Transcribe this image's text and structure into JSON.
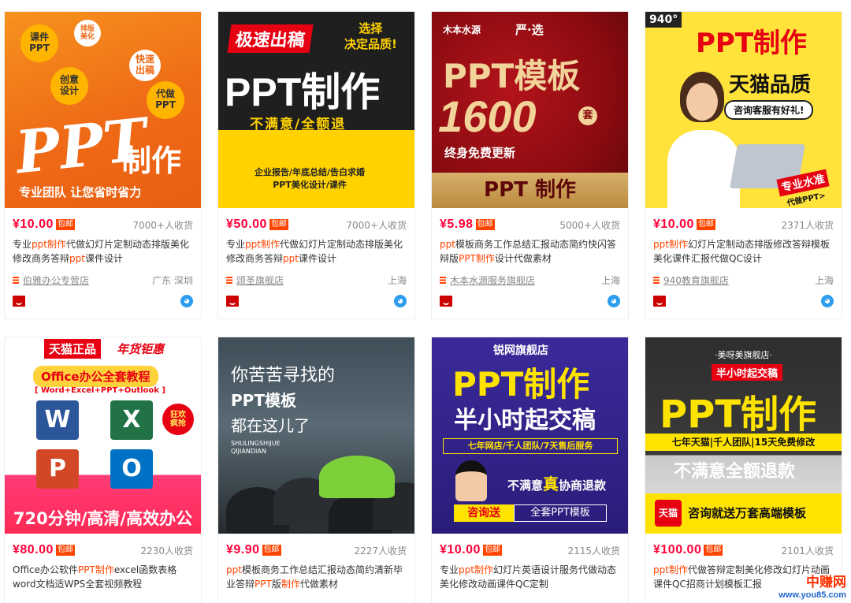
{
  "products": [
    {
      "price": "¥10.00",
      "baoyou": "包邮",
      "sales": "7000+人收货",
      "title_segments": [
        [
          "专业",
          false
        ],
        [
          "ppt制作",
          true
        ],
        [
          "代做幻灯片定制动态排版美化修改商务答辩",
          false
        ],
        [
          "ppt",
          true
        ],
        [
          "课件设计",
          false
        ]
      ],
      "shop": "伯雅办公专营店",
      "location": "广东 深圳",
      "image": {
        "bubbles": [
          "课件\nPPT",
          "排版\n美化",
          "快速\n出稿",
          "创意\n设计",
          "代做\nPPT"
        ],
        "big": "PPT",
        "big2": "制作",
        "sub": "专业团队 让您省时省力"
      }
    },
    {
      "price": "¥50.00",
      "baoyou": "包邮",
      "sales": "7000+人收货",
      "title_segments": [
        [
          "专业",
          false
        ],
        [
          "ppt制作",
          true
        ],
        [
          "代做幻灯片定制动态排版美化修改商务答辩",
          false
        ],
        [
          "ppt",
          true
        ],
        [
          "课件设计",
          false
        ]
      ],
      "shop": "颂圣旗舰店",
      "location": "上海",
      "image": {
        "tag": "极速出稿",
        "side": "选择\n决定品质!",
        "big": "PPT制作",
        "sub": "不满意/全额退",
        "foot": "企业报告/年底总结/告白求婚\nPPT美化设计/课件"
      }
    },
    {
      "price": "¥5.98",
      "baoyou": "包邮",
      "sales": "5000+人收货",
      "title_segments": [
        [
          "ppt",
          true
        ],
        [
          "模板商务工作总结汇报动态简约快闪答辩版",
          false
        ],
        [
          "PPT制作",
          true
        ],
        [
          "设计代做素材",
          false
        ]
      ],
      "shop": "木本水源服务旗舰店",
      "location": "上海",
      "image": {
        "brand": "木本水源",
        "brand2": "严·选",
        "big": "PPT模板",
        "num": "1600",
        "unit": "套",
        "sub": "终身免费更新",
        "foot": "PPT 制作"
      }
    },
    {
      "price": "¥10.00",
      "baoyou": "包邮",
      "sales": "2371人收货",
      "title_segments": [
        [
          "ppt制作",
          true
        ],
        [
          "幻灯片定制动态排版修改答辩模板美化课件汇报代做QC设计",
          false
        ]
      ],
      "shop": "940教育旗舰店",
      "location": "上海",
      "image": {
        "corner": "940°",
        "big": "PPT制作",
        "sub": "天猫品质",
        "note": "咨询客服有好礼!",
        "tag": "专业水准",
        "tag2": "代做PPT>"
      }
    },
    {
      "price": "¥80.00",
      "baoyou": "包邮",
      "sales": "2230人收货",
      "title_segments": [
        [
          "Office办公软件",
          false
        ],
        [
          "PPT制作",
          true
        ],
        [
          "excel函数表格word文档适WPS全套视频教程",
          false
        ]
      ],
      "shop": "",
      "location": "",
      "image": {
        "top": "天猫正品",
        "top2": "年货钜惠",
        "title": "Office办公全套教程",
        "sub": "[ Word+Excel+PPT+Outlook ]",
        "badge": "狂欢\n疯抢",
        "foot": "720分钟/高清/高效办公"
      }
    },
    {
      "price": "¥9.90",
      "baoyou": "包邮",
      "sales": "2227人收货",
      "title_segments": [
        [
          "ppt",
          true
        ],
        [
          "模板商务工作总结汇报动态简约清新毕业答辩",
          false
        ],
        [
          "PPT",
          true
        ],
        [
          "版",
          false
        ],
        [
          "制作",
          true
        ],
        [
          "代做素材",
          false
        ]
      ],
      "shop": "",
      "location": "",
      "image": {
        "l1": "你苦苦寻找的",
        "l2": "PPT模板",
        "l3": "都在这儿了",
        "l4": "SHULINGSHIJUE\nQIJIANDIAN"
      }
    },
    {
      "price": "¥10.00",
      "baoyou": "包邮",
      "sales": "2115人收货",
      "title_segments": [
        [
          "专业",
          false
        ],
        [
          "ppt制作",
          true
        ],
        [
          "幻灯片英语设计服务代做动态美化修改动画课件QC定制",
          false
        ]
      ],
      "shop": "",
      "location": "",
      "image": {
        "top": "锐网旗舰店",
        "big": "PPT制作",
        "sub": "半小时起交稿",
        "bar": "七年网店/千人团队/7天售后服务",
        "promise": "不满意",
        "promise2": "真",
        "promise3": "协商退款",
        "btn1": "咨询送",
        "btn2": "全套PPT模板"
      }
    },
    {
      "price": "¥100.00",
      "baoyou": "包邮",
      "sales": "2101人收货",
      "title_segments": [
        [
          "ppt制作",
          true
        ],
        [
          "代做答辩定制美化修改幻灯片动画课件QC招商计划模板汇报",
          false
        ]
      ],
      "shop": "",
      "location": "",
      "image": {
        "top": "·美呀美旗舰店·",
        "tag": "半小时起交稿",
        "big": "PPT制作",
        "bar": "七年天猫|千人团队|15天免费修改",
        "sub": "不满意全额退款",
        "tmall": "天猫",
        "foot": "咨询就送万套高端模板"
      }
    }
  ],
  "watermark": {
    "cn": "中赚网",
    "url": "www.you85.com"
  }
}
